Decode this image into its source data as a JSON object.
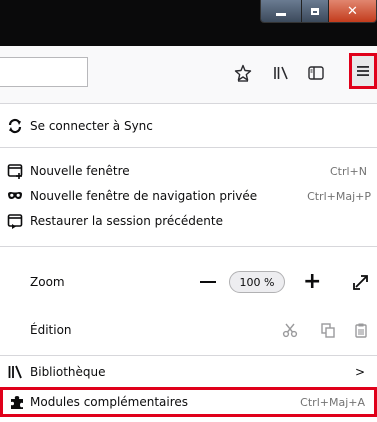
{
  "toolbar": {
    "icons": [
      "star-icon",
      "library-icon",
      "sidebar-icon",
      "hamburger-menu-icon"
    ]
  },
  "menu": {
    "sync": {
      "label": "Se connecter à Sync",
      "icon": "sync-icon"
    },
    "new_window": {
      "label": "Nouvelle fenêtre",
      "shortcut": "Ctrl+N",
      "icon": "new-window-icon"
    },
    "private_window": {
      "label": "Nouvelle fenêtre de navigation privée",
      "shortcut": "Ctrl+Maj+P",
      "icon": "mask-icon"
    },
    "restore_session": {
      "label": "Restaurer la session précédente",
      "icon": "restore-icon"
    },
    "zoom": {
      "label": "Zoom",
      "value": "100 %"
    },
    "edit": {
      "label": "Édition"
    },
    "library": {
      "label": "Bibliothèque",
      "arrow": ">",
      "icon": "library-icon"
    },
    "addons": {
      "label": "Modules complémentaires",
      "shortcut": "Ctrl+Maj+A",
      "icon": "puzzle-icon"
    }
  },
  "colors": {
    "highlight": "#e0001a",
    "titlebar": "#0a0a0b",
    "toolbar": "#f9f9fa"
  }
}
